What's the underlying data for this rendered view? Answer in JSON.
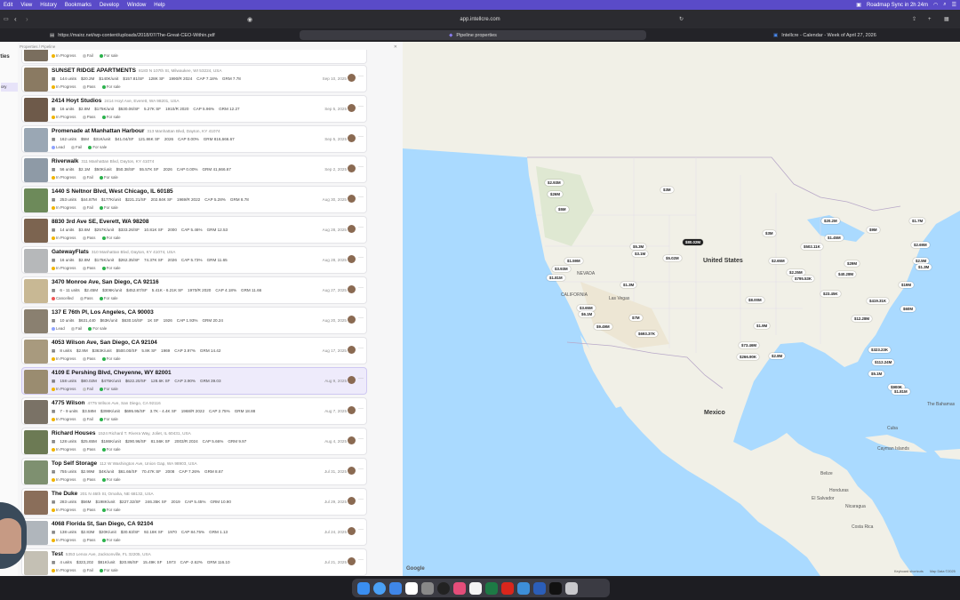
{
  "menubar": {
    "items": [
      "Edit",
      "View",
      "History",
      "Bookmarks",
      "Develop",
      "Window",
      "Help"
    ],
    "status_right": "Roadmap Sync in 2h 24m"
  },
  "browser": {
    "url": "app.intellcre.com",
    "tabs": [
      {
        "label": "https://mairz.net/wp-content/uploads/2018/07/The-Great-CEO-Within.pdf"
      },
      {
        "label": "Pipeline properties"
      },
      {
        "label": "Intellcre - Calendar - Week of April 27, 2026"
      }
    ]
  },
  "sidebar": {
    "frag1": "rties",
    "frag2": "ory"
  },
  "breadcrumb": "Properties / Pipeline",
  "first_chips": {
    "status": "In Progress",
    "s2": "Fail",
    "s3": "For sale"
  },
  "properties": [
    {
      "title": "SUNSET RIDGE APARTMENTS",
      "addr": "8183 N 107th St, Milwaukee, WI 53224, USA",
      "stats": [
        "144 units",
        "$20.2M",
        "$140K/unit",
        "$157.81/SF",
        "128K SF",
        "1990/R 2024",
        "CAP 7.18%",
        "GRM 7.78"
      ],
      "date": "Sep 10, 2025",
      "status": "In Progress",
      "s2": "Pass",
      "s3": "For sale",
      "thumb": "#8a7a62"
    },
    {
      "title": "2414 Hoyt Studios",
      "addr": "2414 Hoyt Ave, Everett, WA 98201, USA",
      "stats": [
        "16 units",
        "$2.8M",
        "$175K/unit",
        "$530.06/SF",
        "5.27K SF",
        "1910/R 2020",
        "CAP 5.96%",
        "GRM 12.27"
      ],
      "date": "Sep 5, 2025",
      "status": "In Progress",
      "s2": "Pass",
      "s3": "For sale",
      "thumb": "#6e5a4a"
    },
    {
      "title": "Promenade at Manhattan Harbour",
      "addr": "313 Manhattan Blvd, Dayton, KY 41074",
      "stats": [
        "162 units",
        "$5M",
        "$31K/unit",
        "$41.04/SF",
        "121.86K SF",
        "2026",
        "CAP 0.00%",
        "GRM 816,666.67"
      ],
      "date": "Sep 5, 2025",
      "status": "Lead",
      "s2": "Fail",
      "s3": "For sale",
      "thumb": "#9aa7b4"
    },
    {
      "title": "Riverwalk",
      "addr": "311 Manhattan Blvd, Dayton, KY 41074",
      "stats": [
        "56 units",
        "$2.1M",
        "$50K/unit",
        "$50.38/SF",
        "55.57K SF",
        "2026",
        "CAP 0.00%",
        "GRM 41,666.67"
      ],
      "date": "Sep 2, 2025",
      "status": "In Progress",
      "s2": "Fail",
      "s3": "For sale",
      "thumb": "#8e9aa6"
    },
    {
      "title": "1440 S Neltnor Blvd, West Chicago, IL 60185",
      "addr": "",
      "stats": [
        "253 units",
        "$44.87M",
        "$177K/unit",
        "$221.21/SF",
        "202.84K SF",
        "1969/R 2022",
        "CAP 5.28%",
        "GRM 8.78"
      ],
      "date": "Aug 30, 2025",
      "status": "In Progress",
      "s2": "Fail",
      "s3": "For sale",
      "thumb": "#6d8a5a"
    },
    {
      "title": "8830 3rd Ave SE, Everett, WA 98208",
      "addr": "",
      "stats": [
        "14 units",
        "$3.6M",
        "$257K/unit",
        "$333.26/SF",
        "10.81K SF",
        "2000",
        "CAP 5.46%",
        "GRM 12.53"
      ],
      "date": "Aug 28, 2025",
      "status": "In Progress",
      "s2": "Pass",
      "s3": "For sale",
      "thumb": "#7c6450"
    },
    {
      "title": "GatewayFlats",
      "addr": "310 Manhattan Blvd, Dayton, KY 41074, USA",
      "stats": [
        "16 units",
        "$2.8M",
        "$175K/unit",
        "$262.35/SF",
        "74.37K SF",
        "2026",
        "CAP 5.73%",
        "GRM 11.65"
      ],
      "date": "Aug 28, 2025",
      "status": "In Progress",
      "s2": "Pass",
      "s3": "For sale",
      "thumb": "#b6b8ba"
    },
    {
      "title": "3470 Monroe Ave, San Diego, CA 92116",
      "addr": "",
      "stats": [
        "6 - 11 units",
        "$2.45M",
        "$306K/unit",
        "$452.87/SF",
        "5.41K - 6.21K SF",
        "1970/R 2020",
        "CAP 4.18%",
        "GRM 11.66"
      ],
      "date": "Aug 27, 2025",
      "status": "Cancelled",
      "s2": "Pass",
      "s3": "For sale",
      "thumb": "#c8b894"
    },
    {
      "title": "137 E 76th Pl, Los Angeles, CA 90003",
      "addr": "",
      "stats": [
        "10 units",
        "$631,440",
        "$63K/unit",
        "$630.16/SF",
        "1K SF",
        "1926",
        "CAP 1.93%",
        "GRM 20.24"
      ],
      "date": "Aug 20, 2025",
      "status": "Lead",
      "s2": "Fail",
      "s3": "For sale",
      "thumb": "#8a8070"
    },
    {
      "title": "4053 Wilson Ave, San Diego, CA 92104",
      "addr": "",
      "stats": [
        "8 units",
        "$2.9M",
        "$363K/unit",
        "$500.00/SF",
        "5.8K SF",
        "1969",
        "CAP 3.97%",
        "GRM 14.42"
      ],
      "date": "Aug 17, 2025",
      "status": "In Progress",
      "s2": "Pass",
      "s3": "For sale",
      "thumb": "#a89a7e"
    },
    {
      "title": "4109 E Pershing Blvd, Cheyenne, WY 82001",
      "addr": "",
      "stats": [
        "158 units",
        "$80.02M",
        "$475K/unit",
        "$622.20/SF",
        "128.6K SF",
        "CAP 3.90%",
        "GRM 39.03"
      ],
      "date": "Aug 9, 2025",
      "status": "In Progress",
      "s2": "Fail",
      "s3": "For sale",
      "thumb": "#9a8c70",
      "hl": true
    },
    {
      "title": "4775 Wilson",
      "addr": "4775 Wilson Ave, San Diego, CA 92116",
      "stats": [
        "7 - 9 units",
        "$3.58M",
        "$398K/unit",
        "$695.95/SF",
        "3.7K - 4.4K SF",
        "1968/R 2022",
        "CAP 2.75%",
        "GRM 18.88"
      ],
      "date": "Aug 7, 2025",
      "status": "In Progress",
      "s2": "Fail",
      "s3": "For sale",
      "thumb": "#7a7266"
    },
    {
      "title": "Richard Houses",
      "addr": "1524 Richard T. Rivera Way, Joliet, IL 60431, USA",
      "stats": [
        "128 units",
        "$25.65M",
        "$186K/unit",
        "$290.96/SF",
        "81.56K SF",
        "2003/R 2024",
        "CAP 5.66%",
        "GRM 9.97"
      ],
      "date": "Aug 4, 2025",
      "status": "In Progress",
      "s2": "Pass",
      "s3": "For sale",
      "thumb": "#6c7a54"
    },
    {
      "title": "Top Self Storage",
      "addr": "112 W Washington Ave, Union Gap, WA 98903, USA",
      "stats": [
        "755 units",
        "$2.99M",
        "$4K/unit",
        "$61.66/SF",
        "70.47K SF",
        "2008",
        "CAP 7.26%",
        "GRM 8.67"
      ],
      "date": "Jul 31, 2025",
      "status": "In Progress",
      "s2": "Pass",
      "s3": "For sale",
      "thumb": "#7e9070"
    },
    {
      "title": "The Duke",
      "addr": "201 N 46th St, Omaha, NE 68132, USA",
      "stats": [
        "283 units",
        "$56M",
        "$198K/unit",
        "$227.32/SF",
        "246.35K SF",
        "2019",
        "CAP 5.45%",
        "GRM 10.90"
      ],
      "date": "Jul 29, 2025",
      "status": "In Progress",
      "s2": "Pass",
      "s3": "For sale",
      "thumb": "#8a6e5a"
    },
    {
      "title": "4068 Florida St, San Diego, CA 92104",
      "addr": "",
      "stats": [
        "138 units",
        "$2.83M",
        "$20K/unit",
        "$30.63/SF",
        "92.18K SF",
        "1970",
        "CAP 84.75%",
        "GRM 1.13"
      ],
      "date": "Jul 24, 2025",
      "status": "In Progress",
      "s2": "Pass",
      "s3": "For sale",
      "thumb": "#b0b6bc"
    },
    {
      "title": "Test",
      "addr": "5353 Lenox Ave, Jacksonville, FL 32205, USA",
      "stats": [
        "4 units",
        "$323,202",
        "$81K/unit",
        "$20.86/SF",
        "15.49K SF",
        "1973",
        "CAP -2.62%",
        "GRM 116.10"
      ],
      "date": "Jul 21, 2025",
      "status": "In Progress",
      "s2": "Fail",
      "s3": "For sale",
      "thumb": "#c4c0b4"
    }
  ],
  "map": {
    "labels": {
      "us": "United States",
      "mexico": "Mexico",
      "cuba": "Cuba",
      "bahamas": "The Bahamas",
      "california": "CALIFORNIA",
      "nevada": "NEVADA",
      "lasvegas": "Las Vegas",
      "cayman": "Cayman Islands",
      "belize": "Belize",
      "honduras": "Honduras",
      "nicaragua": "Nicaragua",
      "elsalvador": "El Salvador",
      "costarica": "Costa Rica",
      "google": "Google",
      "shortcuts": "Keyboard shortcuts",
      "mapdata": "Map Data ©2025"
    },
    "pins": [
      "$2.93M",
      "$26M",
      "$5M",
      "$3M",
      "$80.02M",
      "$5.3M",
      "$3.1M",
      "$5.02M",
      "$1.59M",
      "$3.93M",
      "$1.81M",
      "$1.3M",
      "$3.65M",
      "$6.1M",
      "$7M",
      "$693.37K",
      "$9.49M",
      "$8.00M",
      "$1.9M",
      "$73.46M",
      "$266.90K",
      "$2.8M",
      "$3M",
      "$2.65M",
      "$2.25M",
      "$795.53K",
      "$40.28M",
      "$29M",
      "$502.11K",
      "$1.45M",
      "$20.2M",
      "$9M",
      "$1.7M",
      "$2.5M",
      "$19M",
      "$23.45K",
      "$419.31K",
      "$12.28M",
      "$323.23K",
      "$112.24M",
      "$5.1M",
      "$900K",
      "$1.81M",
      "$2.69M",
      "$1.3M",
      "$60M"
    ],
    "dark_pin": "$80.02M"
  },
  "colors": {
    "accent": "#5a4bc8",
    "map_land": "#f1f0e7",
    "map_water": "#aadaff",
    "highlight": "#eeebfb"
  }
}
